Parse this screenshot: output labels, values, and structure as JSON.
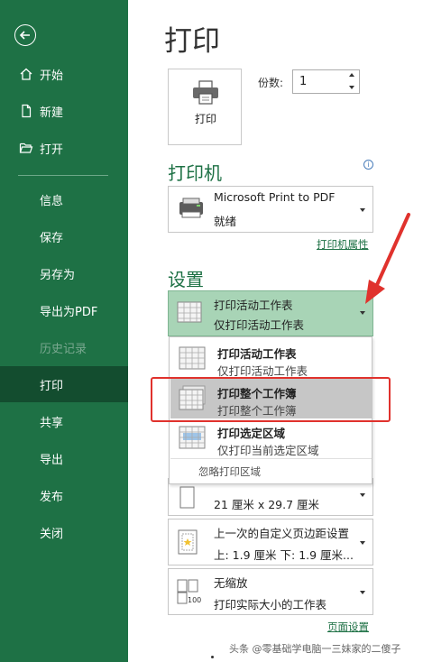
{
  "sidebar": {
    "items": [
      {
        "label": "开始",
        "icon": "home-icon"
      },
      {
        "label": "新建",
        "icon": "new-document-icon"
      },
      {
        "label": "打开",
        "icon": "open-folder-icon"
      },
      {
        "label": "信息"
      },
      {
        "label": "保存"
      },
      {
        "label": "另存为"
      },
      {
        "label": "导出为PDF"
      },
      {
        "label": "历史记录",
        "disabled": true
      },
      {
        "label": "打印",
        "active": true
      },
      {
        "label": "共享"
      },
      {
        "label": "导出"
      },
      {
        "label": "发布"
      },
      {
        "label": "关闭"
      }
    ],
    "colors": {
      "background": "#1e7145",
      "active": "#134d2f"
    }
  },
  "main": {
    "title": "打印",
    "print_button_label": "打印",
    "copies_label": "份数:",
    "copies_value": "1",
    "printer_section": {
      "title": "打印机",
      "printer_name": "Microsoft Print to PDF",
      "printer_status": "就绪",
      "properties_link": "打印机属性"
    },
    "settings_section": {
      "title": "设置",
      "selected": {
        "line1": "打印活动工作表",
        "line2": "仅打印活动工作表"
      },
      "options": [
        {
          "title": "打印活动工作表",
          "desc": "仅打印活动工作表"
        },
        {
          "title": "打印整个工作簿",
          "desc": "打印整个工作簿",
          "selected": true
        },
        {
          "title": "打印选定区域",
          "desc": "仅打印当前选定区域"
        }
      ],
      "ignore_print_area": "忽略打印区域",
      "paper_size_partial": "21 厘米 x 29.7 厘米",
      "margins": {
        "line1": "上一次的自定义页边距设置",
        "line2": "上: 1.9 厘米 下: 1.9 厘米..."
      },
      "scaling": {
        "line1": "无缩放",
        "line2": "打印实际大小的工作表"
      },
      "page_setup_link": "页面设置"
    }
  },
  "watermark": "头条 @零基础学电脑一三妹家的二傻子",
  "colors": {
    "accent_green": "#1e7145",
    "highlight_red": "#e0322d",
    "selected_bg": "#a8d4b6"
  }
}
